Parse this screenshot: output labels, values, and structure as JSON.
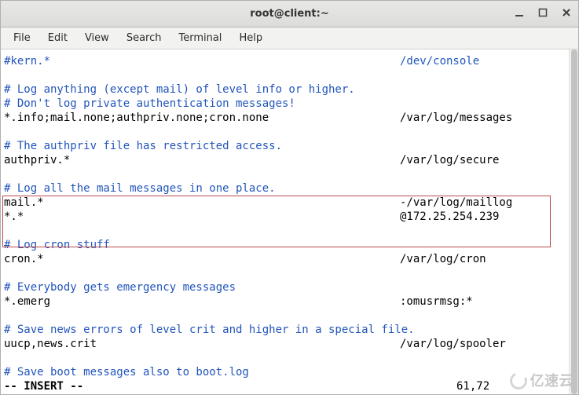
{
  "window": {
    "title": "root@client:~"
  },
  "menu": {
    "file": "File",
    "edit": "Edit",
    "view": "View",
    "search": "Search",
    "terminal": "Terminal",
    "help": "Help"
  },
  "content": {
    "l1a": "#kern.*",
    "l1b": "/dev/console",
    "l2": "# Log anything (except mail) of level info or higher.",
    "l3": "# Don't log private authentication messages!",
    "l4a": "*.info;mail.none;authpriv.none;cron.none",
    "l4b": "/var/log/messages",
    "l5": "# The authpriv file has restricted access.",
    "l6a": "authpriv.*",
    "l6b": "/var/log/secure",
    "l7": "# Log all the mail messages in one place.",
    "l8a": "mail.*",
    "l8b": "-/var/log/maillog",
    "l9a": "*.*",
    "l9b": "@172.25.254.239",
    "l10": "# Log cron stuff",
    "l11a": "cron.*",
    "l11b": "/var/log/cron",
    "l12": "# Everybody gets emergency messages",
    "l13a": "*.emerg",
    "l13b": ":omusrmsg:*",
    "l14": "# Save news errors of level crit and higher in a special file.",
    "l15a": "uucp,news.crit",
    "l15b": "/var/log/spooler",
    "l16": "# Save boot messages also to boot.log"
  },
  "status": {
    "mode": "-- INSERT --",
    "pos": "61,72"
  },
  "watermark": "亿速云"
}
